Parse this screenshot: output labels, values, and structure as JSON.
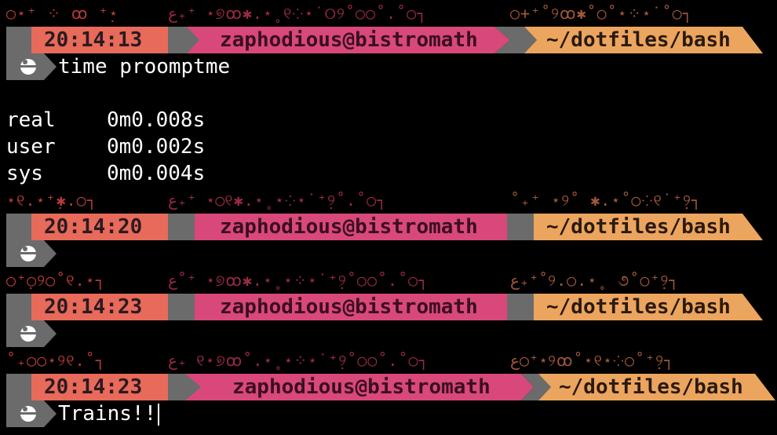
{
  "colors": {
    "time_bg": "#e86a5a",
    "user_bg": "#d9487a",
    "path_bg": "#eca55e",
    "sep_gray": "#6b6b6b",
    "icon_bg": "#6b6b6b",
    "text_white": "#ffffff"
  },
  "blocks": [
    {
      "deco_left": "○⋆⁺ ⁘ ꝏ ⁺̣⋆",
      "deco_mid": "ع₊⁺ ⋆୭ꝏ✱.⋆˳୧⁘⋆˙୦୨˚○○˚.˚○┐",
      "deco_right": "○+⁺˚୨ꝏ✱˚○˚⋆⁘⋆˙˚○┐",
      "time": "20:14:13",
      "user": "zaphodious@bistromath",
      "path": "~/dotfiles/bash",
      "command": "time proomptme"
    },
    {
      "deco_left": "⋆୧.⋆⁺̣✱.○┐",
      "deco_mid": "ع₊⁺ ⋆○୧✱.⋆˳⋆⁘⋆˙⁺̣୨˚.˚○┐",
      "deco_right": "˚₊⁺ ⋆୨˚ ✱.⋆˚○⁘୧˙⁺̣୨┐",
      "time": "20:14:20",
      "user": "zaphodious@bistromath",
      "path": "~/dotfiles/bash",
      "command": ""
    },
    {
      "deco_left": "○⁺̣○୨○˚୧.⋆┐",
      "deco_mid": "ع˚⁺ ⋆୭ꝏ✱.⋆˳⋆⁘⋆˙⁺̣୨˚○○˚.˚○┐",
      "deco_right": "ع₊⁺˚୨.○.⋆˳ ૭˚○⁺̣୨┐",
      "time": "20:14:23",
      "user": "zaphodious@bistromath",
      "path": "~/dotfiles/bash",
      "command": ""
    },
    {
      "deco_left": "˚₊○○⋆୨୧.˚┐",
      "deco_mid": "ع₊ ୧⋆୭ꝏ˚.⋆˳⋆⁘⋆˙⁺̣୨˚○○˚.˚○┐",
      "deco_right": "ع○⁺⋆୨ꝏ˚⋆୧⋆⁘○˚⁺̣୨┐",
      "time": "20:14:23",
      "user": "zaphodious@bistromath",
      "path": "~/dotfiles/bash",
      "command": "Trains!!"
    }
  ],
  "time_output": {
    "real_label": "real",
    "real_value": "0m0.008s",
    "user_label": "user",
    "user_value": "0m0.002s",
    "sys_label": "sys",
    "sys_value": "0m0.004s"
  }
}
